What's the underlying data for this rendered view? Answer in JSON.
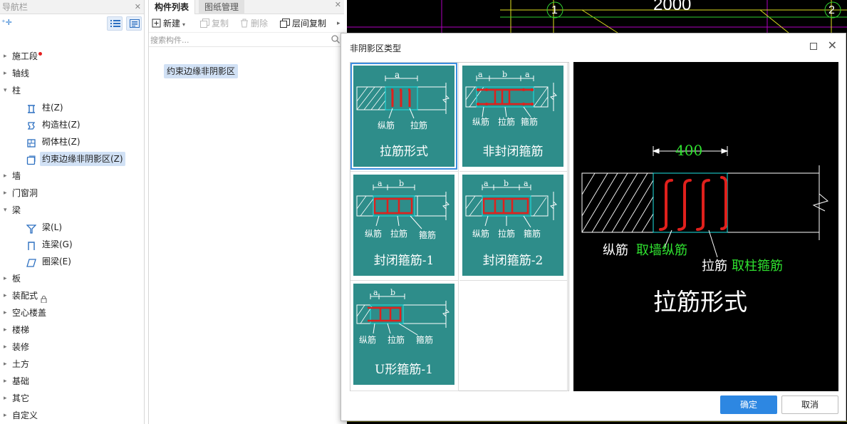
{
  "nav": {
    "title": "导航栏",
    "items": [
      {
        "label": "施工段",
        "type": "group",
        "dot": true
      },
      {
        "label": "轴线",
        "type": "group"
      },
      {
        "label": "柱",
        "type": "group",
        "open": true
      },
      {
        "label": "柱(Z)",
        "type": "child",
        "icon": "column-icon"
      },
      {
        "label": "构造柱(Z)",
        "type": "child",
        "icon": "construct-column-icon"
      },
      {
        "label": "砌体柱(Z)",
        "type": "child",
        "icon": "masonry-column-icon"
      },
      {
        "label": "约束边缘非阴影区(Z)",
        "type": "child",
        "icon": "edge-zone-icon",
        "selected": true
      },
      {
        "label": "墙",
        "type": "group"
      },
      {
        "label": "门窗洞",
        "type": "group"
      },
      {
        "label": "梁",
        "type": "group",
        "open": true
      },
      {
        "label": "梁(L)",
        "type": "child",
        "icon": "beam-icon"
      },
      {
        "label": "连梁(G)",
        "type": "child",
        "icon": "link-beam-icon"
      },
      {
        "label": "圈梁(E)",
        "type": "child",
        "icon": "ring-beam-icon"
      },
      {
        "label": "板",
        "type": "group"
      },
      {
        "label": "装配式",
        "type": "group",
        "lock": true
      },
      {
        "label": "空心楼盖",
        "type": "group"
      },
      {
        "label": "楼梯",
        "type": "group"
      },
      {
        "label": "装修",
        "type": "group"
      },
      {
        "label": "土方",
        "type": "group"
      },
      {
        "label": "基础",
        "type": "group"
      },
      {
        "label": "其它",
        "type": "group"
      },
      {
        "label": "自定义",
        "type": "group"
      }
    ]
  },
  "component_panel": {
    "tabs": [
      "构件列表",
      "图纸管理"
    ],
    "toolbar": {
      "new": "新建",
      "copy": "复制",
      "delete": "删除",
      "floor_copy": "层间复制"
    },
    "search_placeholder": "搜索构件...",
    "items": [
      "约束边缘非阴影区"
    ]
  },
  "dialog": {
    "title": "非阴影区类型",
    "options": [
      {
        "caption": "拉筋形式",
        "labels": [
          "纵筋",
          "拉筋"
        ],
        "dims": [
          "a"
        ],
        "selected": true
      },
      {
        "caption": "非封闭箍筋",
        "labels": [
          "纵筋",
          "拉筋",
          "箍筋"
        ],
        "dims": [
          "a",
          "b",
          "a"
        ]
      },
      {
        "caption": "封闭箍筋-1",
        "labels": [
          "纵筋",
          "拉筋",
          "箍筋"
        ],
        "dims": [
          "a",
          "b"
        ]
      },
      {
        "caption": "封闭箍筋-2",
        "labels": [
          "纵筋",
          "拉筋",
          "箍筋"
        ],
        "dims": [
          "a",
          "b",
          "a"
        ]
      },
      {
        "caption": "U形箍筋-1",
        "labels": [
          "纵筋",
          "拉筋",
          "箍筋"
        ],
        "dims": [
          "a",
          "b"
        ]
      }
    ],
    "preview": {
      "dimension": "400",
      "label_long": "纵筋",
      "label_long_value": "取墙纵筋",
      "label_tie": "拉筋",
      "label_tie_value": "取柱箍筋",
      "title": "拉筋形式"
    },
    "ok": "确定",
    "cancel": "取消"
  },
  "cad_axis_labels": [
    "1",
    "2"
  ],
  "cad_dim_text": "2000",
  "colors": {
    "card": "#2e8d8a",
    "accent": "#2d87e2",
    "rebar": "#e0201c",
    "dim_green": "#2fe02f"
  }
}
